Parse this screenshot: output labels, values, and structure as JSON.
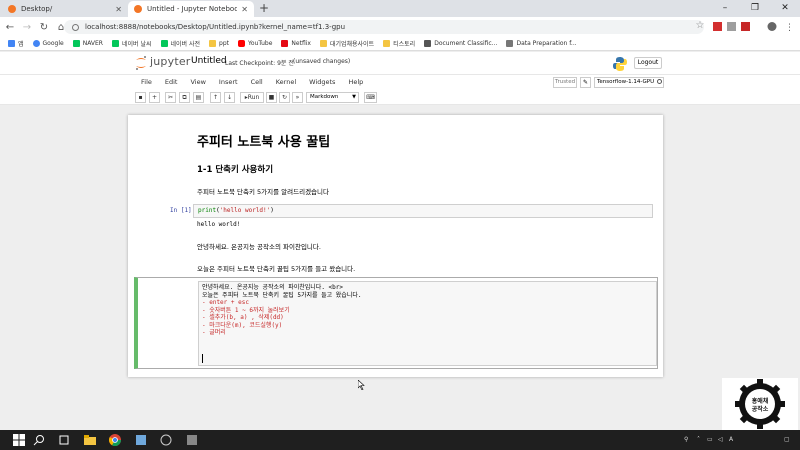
{
  "browser": {
    "tabs": [
      {
        "title": "Desktop/",
        "active": false
      },
      {
        "title": "Untitled - Jupyter Notebook",
        "active": true
      }
    ],
    "new_tab": "+",
    "url": "localhost:8888/notebooks/Desktop/Untitled.ipynb?kernel_name=tf1.3-gpu",
    "bookmarks": [
      {
        "label": "앱",
        "icon": "apps-grid-icon",
        "color": "#4285f4"
      },
      {
        "label": "Google",
        "icon": "google-icon",
        "color": "#4285f4"
      },
      {
        "label": "NAVER",
        "icon": "naver-icon",
        "color": "#03c75a"
      },
      {
        "label": "네이버 날씨",
        "icon": "naver-icon",
        "color": "#03c75a"
      },
      {
        "label": "네이버 사전",
        "icon": "naver-icon",
        "color": "#03c75a"
      },
      {
        "label": "ppt",
        "icon": "folder-icon",
        "color": "#f4c542"
      },
      {
        "label": "YouTube",
        "icon": "youtube-icon",
        "color": "#ff0000"
      },
      {
        "label": "Netflix",
        "icon": "netflix-icon",
        "color": "#e50914"
      },
      {
        "label": "대기업채용사이트",
        "icon": "folder-icon",
        "color": "#f4c542"
      },
      {
        "label": "티스토리",
        "icon": "folder-icon",
        "color": "#f4c542"
      },
      {
        "label": "Document Classific...",
        "icon": "document-icon",
        "color": "#555555"
      },
      {
        "label": "Data Preparation f...",
        "icon": "image-icon",
        "color": "#777777"
      }
    ]
  },
  "jupyter": {
    "brand": "jupyter",
    "notebook_name": "Untitled",
    "checkpoint": "Last Checkpoint: 9분 전",
    "unsaved": "(unsaved changes)",
    "logout": "Logout",
    "menu": [
      "File",
      "Edit",
      "View",
      "Insert",
      "Cell",
      "Kernel",
      "Widgets",
      "Help"
    ],
    "trusted": "Trusted",
    "kernel": "Tensorflow-1.14-GPU",
    "toolbar": {
      "run": "Run",
      "cell_type": "Markdown"
    },
    "accent_color": "#f37626"
  },
  "notebook": {
    "h1": "주피터 노트북 사용 꿀팁",
    "h2": "1-1 단축키 사용하기",
    "intro": "주피터 노트북 단축키 5가지를 알려드리겠습니다",
    "prompt": "In [1]:",
    "code_fn": "print",
    "code_str": "'hello world!'",
    "code_open": "(",
    "code_close": ")",
    "output": "hello world!",
    "para1": "안녕하세요. 온공지능 공작소의 파이찬입니다.",
    "para2": "오늘은 주피터 노트북 단축키 꿀팁 5가지를 들고 왔습니다.",
    "edit_lines": [
      {
        "text": "안녕하세요. 온공지능 공작소의 파이찬입니다. <br>",
        "cls": ""
      },
      {
        "text": "오늘은 주피터 노트북 단축키 꿀팁 5가지를 들고 왔습니다.",
        "cls": ""
      },
      {
        "text": "",
        "cls": ""
      },
      {
        "text": "- enter + esc",
        "cls": "red"
      },
      {
        "text": "- 숫자버튼 1 ~ 6까지 눌러보기",
        "cls": "red"
      },
      {
        "text": "- 셀추가(b, a) , 삭제(dd)",
        "cls": "red"
      },
      {
        "text": "- 마크다운(m), 코드실행(y)",
        "cls": "red"
      },
      {
        "text": "- 글머리",
        "cls": "red"
      }
    ]
  },
  "badge": {
    "line1": "홍애채",
    "line2": "공작소"
  },
  "taskbar": {
    "time": "",
    "lang": "A"
  }
}
